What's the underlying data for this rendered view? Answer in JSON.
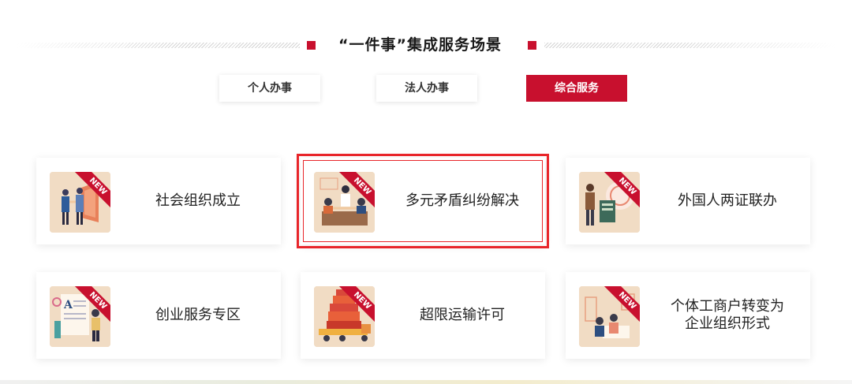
{
  "header": {
    "title": "“一件事”集成服务场景"
  },
  "tabs": [
    {
      "label": "个人办事",
      "active": false
    },
    {
      "label": "法人办事",
      "active": false
    },
    {
      "label": "综合服务",
      "active": true
    }
  ],
  "badge_text": "NEW",
  "cards": [
    {
      "label": "社会组织成立",
      "icon": "business-handshake-icon",
      "selected": false
    },
    {
      "label": "多元矛盾纠纷解决",
      "icon": "mediation-meeting-icon",
      "selected": true
    },
    {
      "label": "外国人两证联办",
      "icon": "foreigner-documents-icon",
      "selected": false
    },
    {
      "label": "创业服务专区",
      "icon": "startup-document-icon",
      "selected": false
    },
    {
      "label": "超限运输许可",
      "icon": "oversize-truck-icon",
      "selected": false
    },
    {
      "label": "个体工商户转变为企业组织形式",
      "icon": "business-transform-icon",
      "selected": false
    }
  ],
  "colors": {
    "accent": "#c8102e",
    "selected_outline": "#e8252a",
    "thumb_bg": "#efd9c0"
  }
}
